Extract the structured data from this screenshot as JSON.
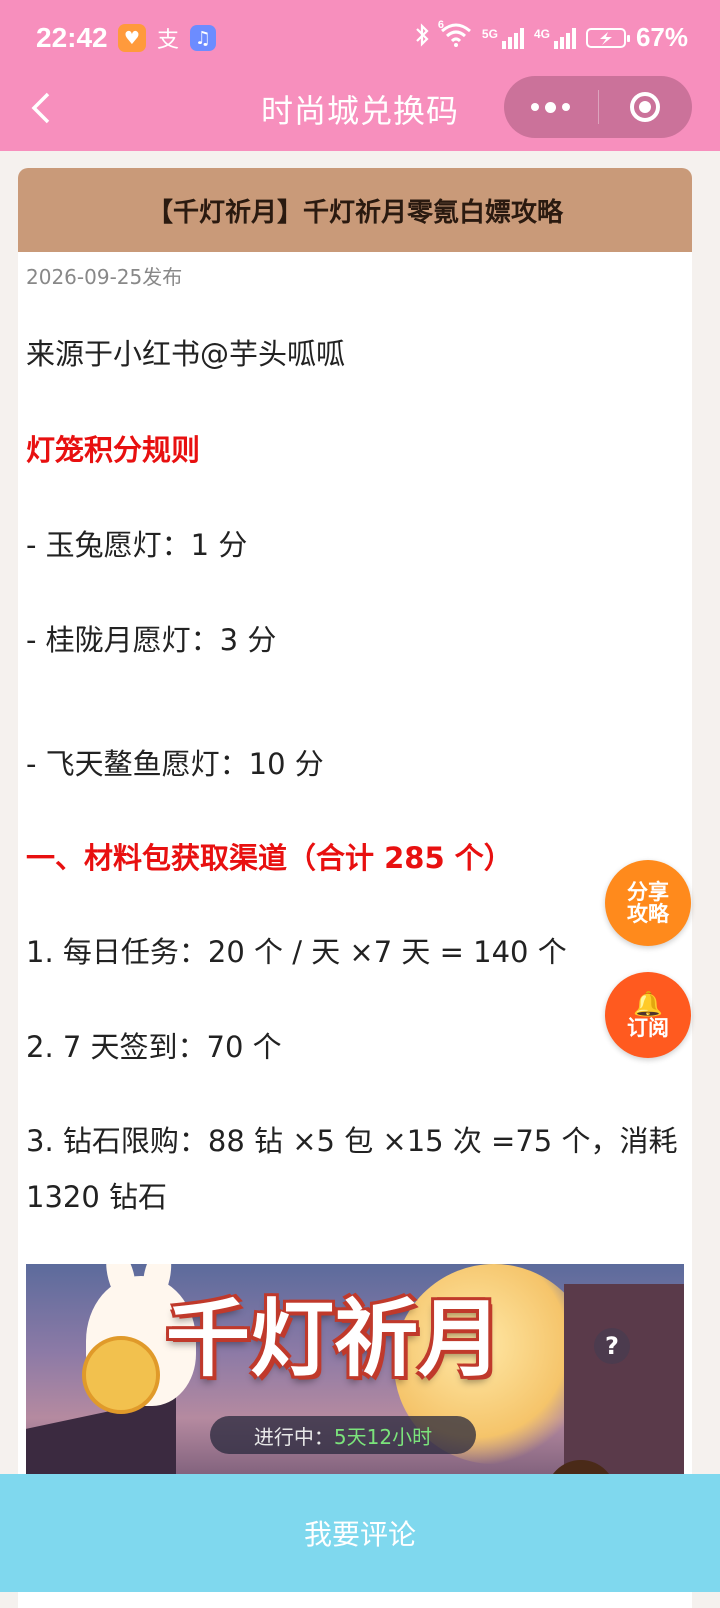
{
  "status": {
    "time": "22:42",
    "sig5g": "5G",
    "sig4g": "4G",
    "wifi_sup": "6",
    "battery": "67%"
  },
  "nav": {
    "title": "时尚城兑换码"
  },
  "article": {
    "title": "【千灯祈月】千灯祈月零氪白嫖攻略",
    "date": "2026-09-25发布",
    "source": "来源于小红书@芋头呱呱",
    "sec1": "灯笼积分规则",
    "item1": "- 玉兔愿灯：1 分",
    "item2": "- 桂陇月愿灯：3 分",
    "item3": "- 飞天鳌鱼愿灯：10 分",
    "sec2": "一、材料包获取渠道（合计 285 个）",
    "line1": "1. 每日任务：20 个 / 天 ×7 天 = 140 个",
    "line2": "2. 7 天签到：70 个",
    "line3a": "3. 钻石限购：88 钻 ×5 包 ×15 次 =75 个，消耗",
    "line3b": "1320 钻石"
  },
  "banner": {
    "title": "千灯祈月",
    "progress_label": "进行中：",
    "progress_value": "5天12小时"
  },
  "fab": {
    "share_line1": "分享",
    "share_line2": "攻略",
    "subscribe": "订阅"
  },
  "bottom": {
    "comment": "我要评论"
  }
}
